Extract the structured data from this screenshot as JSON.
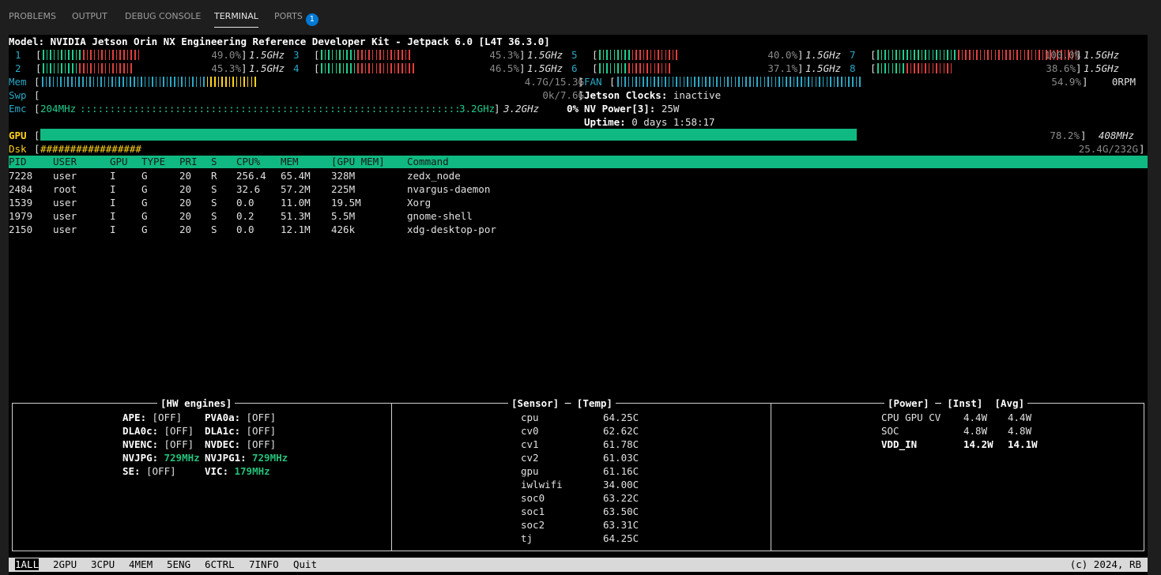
{
  "tabs": [
    {
      "label": "PROBLEMS"
    },
    {
      "label": "OUTPUT"
    },
    {
      "label": "DEBUG CONSOLE"
    },
    {
      "label": "TERMINAL",
      "active": true
    },
    {
      "label": "PORTS",
      "badge": "1"
    }
  ],
  "model": "Model: NVIDIA Jetson Orin NX Engineering Reference Developer Kit - Jetpack 6.0 [L4T 36.3.0]",
  "cpus": [
    {
      "id": "1",
      "usage": "49.0%",
      "freq": "1.5GHz",
      "fill": 0.49
    },
    {
      "id": "2",
      "usage": "45.3%",
      "freq": "1.5GHz",
      "fill": 0.453
    },
    {
      "id": "3",
      "usage": "45.3%",
      "freq": "1.5GHz",
      "fill": 0.453
    },
    {
      "id": "4",
      "usage": "46.5%",
      "freq": "1.5GHz",
      "fill": 0.465
    },
    {
      "id": "5",
      "usage": "40.0%",
      "freq": "1.5GHz",
      "fill": 0.4
    },
    {
      "id": "6",
      "usage": "37.1%",
      "freq": "1.5GHz",
      "fill": 0.371
    },
    {
      "id": "7",
      "usage": "100.0%",
      "freq": "1.5GHz",
      "fill": 1.0
    },
    {
      "id": "8",
      "usage": "38.6%",
      "freq": "1.5GHz",
      "fill": 0.386
    }
  ],
  "mem": {
    "label": "Mem",
    "value": "4.7G/15.3G",
    "fill": 0.307
  },
  "swp": {
    "label": "Swp",
    "value": "0k/7.6G"
  },
  "emc": {
    "label": "Emc",
    "min": "204MHz",
    "max": "3.2GHz",
    "freq": "3.2GHz",
    "usage": "0%"
  },
  "fan": {
    "label": "FAN",
    "value": "54.9%",
    "rpm": "0RPM",
    "fill": 0.549
  },
  "jetson_clocks": {
    "label": "Jetson Clocks:",
    "value": "inactive"
  },
  "nv_power": {
    "label": "NV Power[3]:",
    "value": "25W"
  },
  "uptime": {
    "label": "Uptime:",
    "value": "0 days 1:58:17"
  },
  "gpu": {
    "label": "GPU",
    "value": "78.2%",
    "freq": "408MHz",
    "fill": 0.782
  },
  "dsk": {
    "label": "Dsk",
    "bar": "#################",
    "value": "25.4G/232G"
  },
  "proc_headers": [
    "PID",
    "USER",
    "GPU",
    "TYPE",
    "PRI",
    "S",
    "CPU%",
    "MEM",
    "[GPU MEM]",
    "Command"
  ],
  "processes": [
    [
      "7228",
      "user",
      "I",
      "G",
      "20",
      "R",
      "256.4",
      "65.4M",
      "328M",
      "zedx_node"
    ],
    [
      "2484",
      "root",
      "I",
      "G",
      "20",
      "S",
      "32.6",
      "57.2M",
      "225M",
      "nvargus-daemon"
    ],
    [
      "1539",
      "user",
      "I",
      "G",
      "20",
      "S",
      "0.0",
      "11.0M",
      "19.5M",
      "Xorg"
    ],
    [
      "1979",
      "user",
      "I",
      "G",
      "20",
      "S",
      "0.2",
      "51.3M",
      "5.5M",
      "gnome-shell"
    ],
    [
      "2150",
      "user",
      "I",
      "G",
      "20",
      "S",
      "0.0",
      "12.1M",
      "426k",
      "xdg-desktop-por"
    ]
  ],
  "hw_engines": {
    "title": "[HW engines]",
    "rows": [
      [
        {
          "label": "APE:",
          "value": "[OFF]"
        },
        {
          "label": "PVA0a:",
          "value": "[OFF]"
        }
      ],
      [
        {
          "label": "DLA0c:",
          "value": "[OFF]"
        },
        {
          "label": "DLA1c:",
          "value": "[OFF]"
        }
      ],
      [
        {
          "label": "NVENC:",
          "value": "[OFF]"
        },
        {
          "label": "NVDEC:",
          "value": "[OFF]"
        }
      ],
      [
        {
          "label": "NVJPG:",
          "value": "729MHz",
          "on": true
        },
        {
          "label": "NVJPG1:",
          "value": "729MHz",
          "on": true
        }
      ],
      [
        {
          "label": "SE:",
          "value": "[OFF]"
        },
        {
          "label": "VIC:",
          "value": "179MHz",
          "on": true
        }
      ]
    ]
  },
  "sensors": {
    "title_sensor": "[Sensor]",
    "title_temp": "[Temp]",
    "rows": [
      [
        "cpu",
        "64.25C"
      ],
      [
        "cv0",
        "62.62C"
      ],
      [
        "cv1",
        "61.78C"
      ],
      [
        "cv2",
        "61.03C"
      ],
      [
        "gpu",
        "61.16C"
      ],
      [
        "iwlwifi",
        "34.00C"
      ],
      [
        "soc0",
        "63.22C"
      ],
      [
        "soc1",
        "63.50C"
      ],
      [
        "soc2",
        "63.31C"
      ],
      [
        "tj",
        "64.25C"
      ]
    ]
  },
  "power": {
    "title_power": "[Power]",
    "title_inst": "[Inst]",
    "title_avg": "[Avg]",
    "rows": [
      {
        "name": "CPU GPU CV",
        "inst": "4.4W",
        "avg": "4.4W"
      },
      {
        "name": "SOC",
        "inst": "4.8W",
        "avg": "4.8W"
      },
      {
        "name": "VDD_IN",
        "inst": "14.2W",
        "avg": "14.1W",
        "bold": true
      }
    ]
  },
  "footer": {
    "keys": [
      {
        "key": "1",
        "label": "ALL",
        "selected": true
      },
      {
        "key": "2",
        "label": "GPU"
      },
      {
        "key": "3",
        "label": "CPU"
      },
      {
        "key": "4",
        "label": "MEM"
      },
      {
        "key": "5",
        "label": "ENG"
      },
      {
        "key": "6",
        "label": "CTRL"
      },
      {
        "key": "7",
        "label": "INFO"
      },
      {
        "key": "",
        "label": "Quit"
      }
    ],
    "copyright": "(c) 2024, RB"
  },
  "colors": {
    "accent_green": "#10b981",
    "cyan": "#2aa8c5",
    "red": "#e23d3d",
    "yellow": "#ffd21a",
    "tab_badge": "#0078d4"
  }
}
